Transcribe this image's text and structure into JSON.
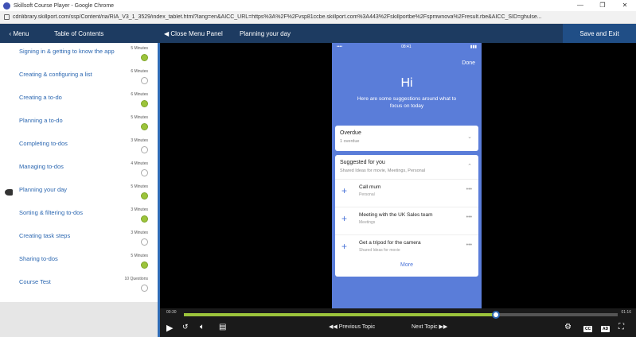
{
  "browser": {
    "window_title": "Skillsoft Course Player - Google Chrome",
    "url": "cdnlibrary.skillport.com/ssp/Content/ria/RIA_V3_1_3529/index_tablet.html?lang=en&AICC_URL=https%3A%2F%2Fvsp81ccbe.skillport.com%3A443%2Fskillportbe%2Fspmwnova%2Fresult.rbe&AICC_SID=ghulse..."
  },
  "topnav": {
    "menu_label": "Menu",
    "toc_title": "Table of Contents",
    "close_panel_label": "Close Menu Panel",
    "topic_title": "Planning your day",
    "save_exit_label": "Save and Exit"
  },
  "sidebar": {
    "items": [
      {
        "label": "Signing in & getting to know the app",
        "duration": "5 Minutes",
        "done": true
      },
      {
        "label": "Creating & configuring a list",
        "duration": "6 Minutes",
        "done": false
      },
      {
        "label": "Creating a to-do",
        "duration": "6 Minutes",
        "done": true
      },
      {
        "label": "Planning a to-do",
        "duration": "5 Minutes",
        "done": true
      },
      {
        "label": "Completing to-dos",
        "duration": "3 Minutes",
        "done": false
      },
      {
        "label": "Managing to-dos",
        "duration": "4 Minutes",
        "done": false
      },
      {
        "label": "Planning your day",
        "duration": "5 Minutes",
        "done": true,
        "current": true
      },
      {
        "label": "Sorting & filtering to-dos",
        "duration": "3 Minutes",
        "done": true
      },
      {
        "label": "Creating task steps",
        "duration": "3 Minutes",
        "done": false
      },
      {
        "label": "Sharing to-dos",
        "duration": "5 Minutes",
        "done": true
      },
      {
        "label": "Course Test",
        "duration": "10 Questions",
        "done": false
      }
    ]
  },
  "phone": {
    "status_left": "••••",
    "status_time": "08:41",
    "status_right": "▮▮▮",
    "done_label": "Done",
    "greeting": "Hi",
    "subtitle": "Here are some suggestions around what to focus on today",
    "overdue": {
      "title": "Overdue",
      "sub": "1 overdue"
    },
    "suggested": {
      "title": "Suggested for you",
      "sub": "Shared Ideas for movie, Meetings, Personal",
      "tasks": [
        {
          "name": "Call mum",
          "sub": "Personal"
        },
        {
          "name": "Meeting with the UK Sales team",
          "sub": "Meetings"
        },
        {
          "name": "Get a tripod for the camera",
          "sub": "Shared Ideas for movie"
        }
      ],
      "more_label": "More"
    }
  },
  "player": {
    "current_time": "00:30",
    "total_time": "01:16",
    "progress": 0.72,
    "prev_label": "Previous Topic",
    "next_label": "Next Topic",
    "cc_label": "CC",
    "ad_label": "AD"
  },
  "colors": {
    "nav_bg": "#1d3b61",
    "accent_green": "#9cc43b",
    "link_blue": "#2a66b0",
    "phone_blue": "#5a7dd9"
  }
}
